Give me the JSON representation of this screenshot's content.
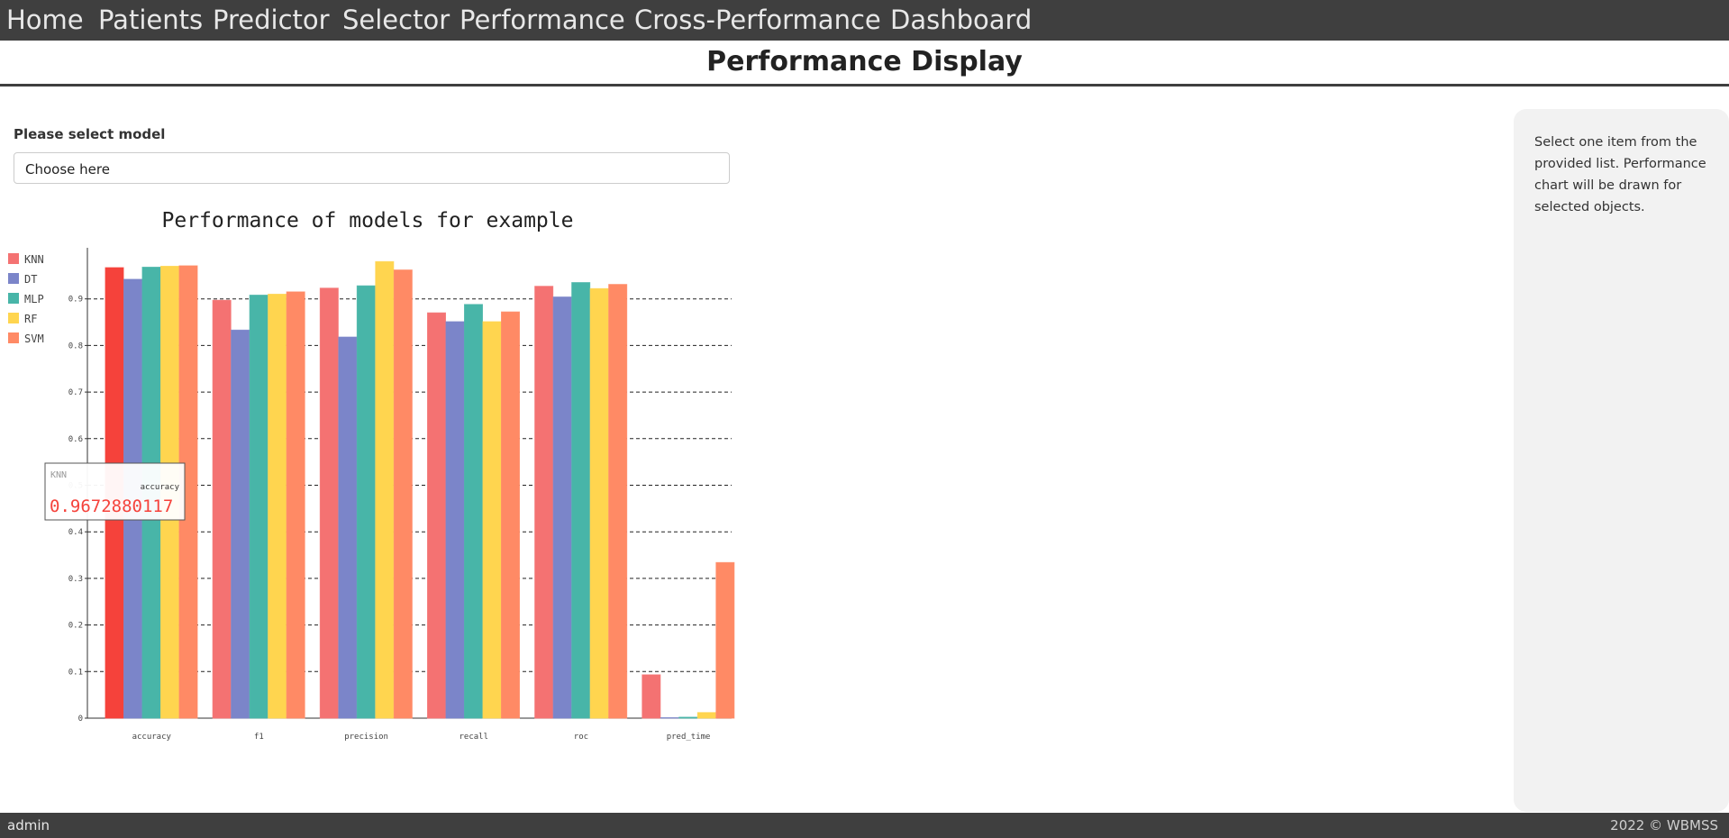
{
  "nav": {
    "items": [
      "Home",
      "Patients",
      "Predictor",
      "Selector",
      "Performance",
      "Cross-Performance",
      "Dashboard"
    ]
  },
  "page_title": "Performance Display",
  "model_select": {
    "label": "Please select model",
    "placeholder": "Choose here"
  },
  "help_text": "Select one item from the provided list. Performance chart will be drawn for selected objects.",
  "footer": {
    "user": "admin",
    "copyright": "2022 © WBMSS"
  },
  "tooltip": {
    "series": "KNN",
    "category": "accuracy",
    "value": "0.9672880117"
  },
  "chart_data": {
    "type": "bar",
    "title": "Performance of models for example",
    "categories": [
      "accuracy",
      "f1",
      "precision",
      "recall",
      "roc",
      "pred_time"
    ],
    "ylim": [
      0,
      1
    ],
    "yticks": [
      0,
      0.1,
      0.2,
      0.3,
      0.4,
      0.5,
      0.6,
      0.7,
      0.8,
      0.9
    ],
    "grid": true,
    "legend_position": "top-left",
    "series": [
      {
        "name": "KNN",
        "color": "#f47272",
        "values": [
          0.967,
          0.897,
          0.923,
          0.87,
          0.927,
          0.093
        ]
      },
      {
        "name": "DT",
        "color": "#7b85c9",
        "values": [
          0.942,
          0.833,
          0.818,
          0.851,
          0.904,
          0.001
        ]
      },
      {
        "name": "MLP",
        "color": "#48b5a8",
        "values": [
          0.968,
          0.908,
          0.928,
          0.888,
          0.935,
          0.002
        ]
      },
      {
        "name": "RF",
        "color": "#ffd54f",
        "values": [
          0.97,
          0.91,
          0.98,
          0.851,
          0.922,
          0.012
        ]
      },
      {
        "name": "SVM",
        "color": "#ff8a65",
        "values": [
          0.971,
          0.915,
          0.962,
          0.872,
          0.931,
          0.334
        ]
      }
    ],
    "highlight": {
      "series": "KNN",
      "category": "accuracy",
      "color": "#f5423b"
    }
  }
}
